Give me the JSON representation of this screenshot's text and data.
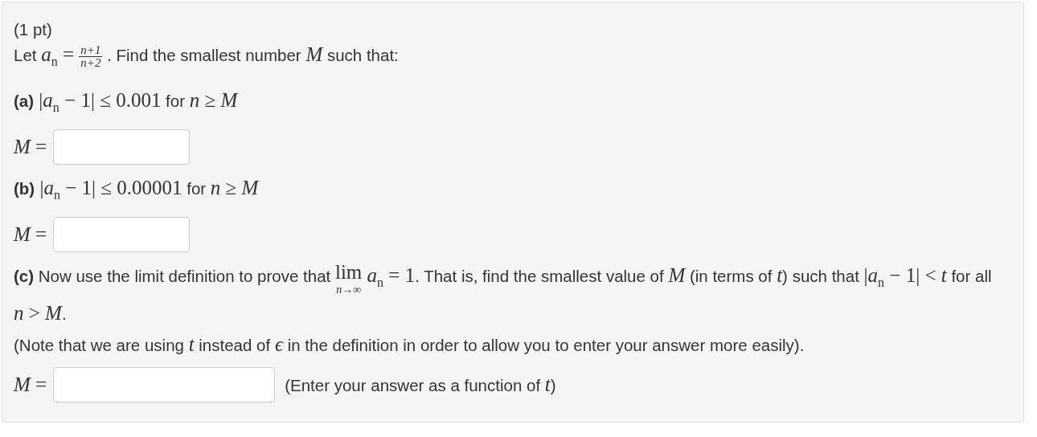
{
  "points": "(1 pt)",
  "items": [
    {
      "kind": "text",
      "segments": [
        {
          "kind": "text",
          "text": "Let "
        },
        {
          "kind": "math",
          "text": "*a*$_{n}$ = "
        },
        {
          "kind": "frac",
          "num": "n+1",
          "den": "n+2"
        },
        {
          "kind": "text",
          "text": " . Find the smallest number "
        },
        {
          "kind": "math",
          "text": "*M*"
        },
        {
          "kind": "text",
          "text": " such that:"
        }
      ]
    },
    {
      "kind": "part",
      "segments": [
        {
          "kind": "bold",
          "text": "(a)"
        },
        {
          "kind": "math",
          "text": " |*a*$_{n}$ − 1| ≤ 0.001"
        },
        {
          "kind": "text",
          "text": " for "
        },
        {
          "kind": "math",
          "text": "*n* ≥ *M*"
        }
      ]
    },
    {
      "kind": "answer",
      "label": "*M* =",
      "value": ""
    },
    {
      "kind": "part",
      "segments": [
        {
          "kind": "bold",
          "text": "(b)"
        },
        {
          "kind": "math",
          "text": " |*a*$_{n}$ − 1| ≤ 0.00001"
        },
        {
          "kind": "text",
          "text": " for "
        },
        {
          "kind": "math",
          "text": "*n* ≥ *M*"
        }
      ]
    },
    {
      "kind": "answer",
      "label": "*M* =",
      "value": ""
    },
    {
      "kind": "part",
      "segments": [
        {
          "kind": "bold",
          "text": "(c)"
        },
        {
          "kind": "text",
          "text": " Now use the limit definition to prove that "
        },
        {
          "kind": "lim",
          "top": "lim",
          "bottom": "n→∞"
        },
        {
          "kind": "math",
          "text": " *a*$_{n}$ = 1"
        },
        {
          "kind": "text",
          "text": ". That is, find the smallest value of "
        },
        {
          "kind": "math",
          "text": "*M*"
        },
        {
          "kind": "text",
          "text": " (in terms of "
        },
        {
          "kind": "math",
          "text": "*t*"
        },
        {
          "kind": "text",
          "text": ") such that "
        },
        {
          "kind": "math",
          "text": "|*a*$_{n}$ − 1| < *t*"
        },
        {
          "kind": "text",
          "text": " for all "
        },
        {
          "kind": "math",
          "text": "*n* > *M*"
        },
        {
          "kind": "text",
          "text": "."
        }
      ]
    },
    {
      "kind": "note",
      "segments": [
        {
          "kind": "text",
          "text": "(Note that we are using "
        },
        {
          "kind": "math",
          "text": "*t*"
        },
        {
          "kind": "text",
          "text": " instead of "
        },
        {
          "kind": "math",
          "text": "*ϵ*"
        },
        {
          "kind": "text",
          "text": " in the definition in order to allow you to enter your answer more easily)."
        }
      ]
    },
    {
      "kind": "answer",
      "label": "*M* =",
      "value": "",
      "hint": [
        {
          "kind": "text",
          "text": "(Enter your answer as a function of "
        },
        {
          "kind": "math",
          "text": "*t*"
        },
        {
          "kind": "text",
          "text": ")"
        }
      ]
    }
  ]
}
